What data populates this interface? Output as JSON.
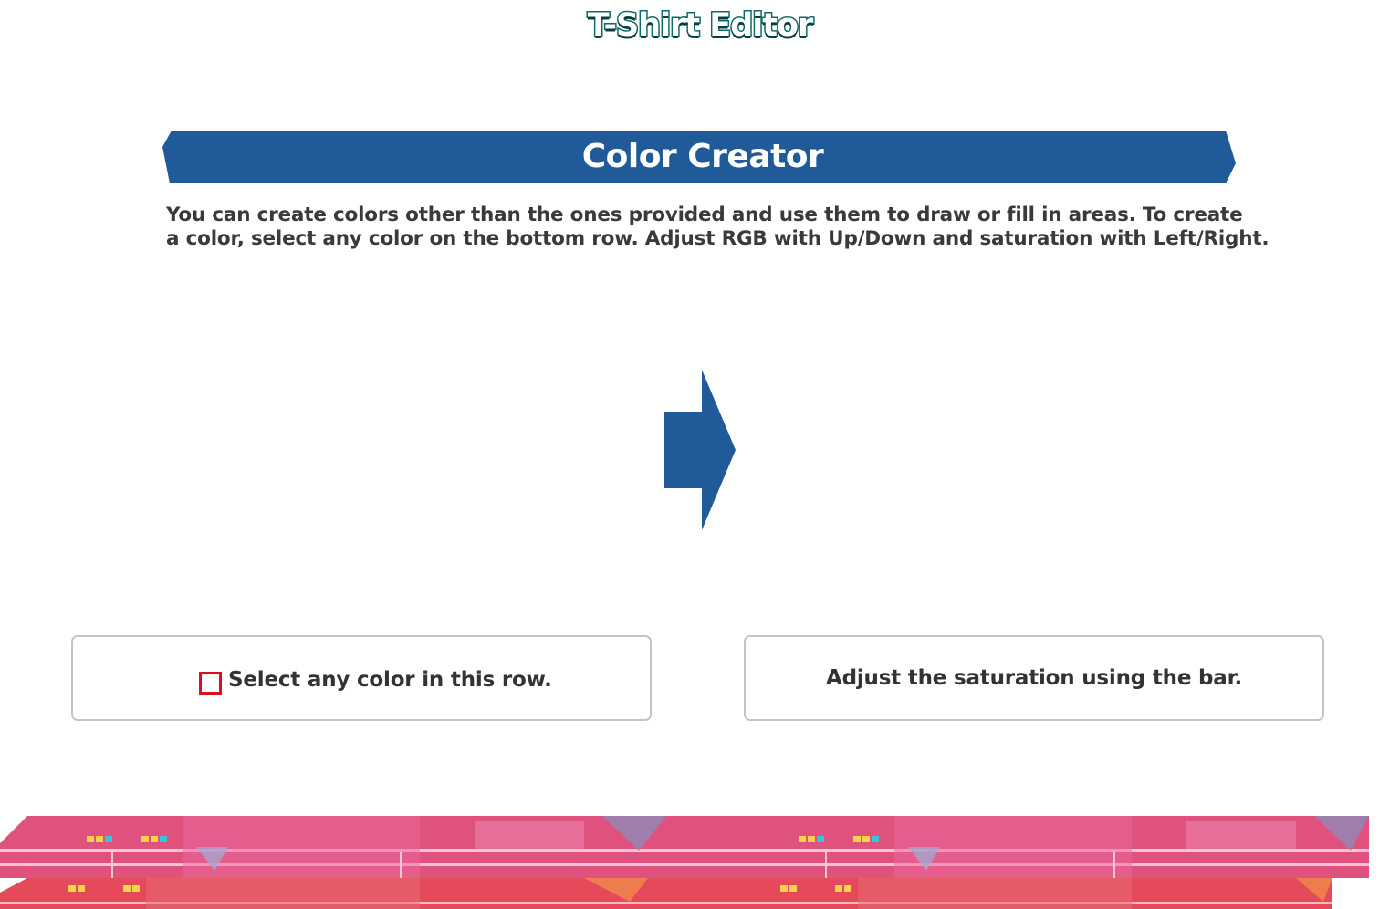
{
  "app": {
    "title": "T-Shirt Editor"
  },
  "section": {
    "title": "Color Creator",
    "description_lines": [
      "You can create colors other than the ones provided and use them to draw or fill in areas. To create",
      "a color, select any color on the bottom row. Adjust RGB with Up/Down and saturation with Left/Right."
    ]
  },
  "hints": {
    "left": {
      "text": "Select any color in this row.",
      "marker_icon": "red-outline-square-icon"
    },
    "right": {
      "text": "Adjust the saturation using the bar."
    }
  },
  "colors": {
    "banner": "#215a99",
    "arrow": "#215a99",
    "title_outline": "#0e6b6a",
    "selector": "#d8121c",
    "strip_top": "#e0527e",
    "strip_bottom": "#e44a5a"
  }
}
